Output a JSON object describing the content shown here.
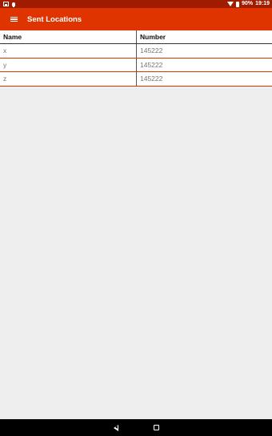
{
  "status_bar": {
    "icons_left": [
      "image-icon",
      "bulb-icon"
    ],
    "icons_right": [
      "wifi-icon",
      "battery-icon"
    ],
    "battery": "90%",
    "time": "19:19"
  },
  "app_bar": {
    "menu_icon": "hamburger-icon",
    "title": "Sent Locations"
  },
  "table": {
    "headers": [
      "Name",
      "Number"
    ],
    "rows": [
      [
        "x",
        "145222"
      ],
      [
        "y",
        "145222"
      ],
      [
        "z",
        "145222"
      ]
    ]
  },
  "nav_bar": {
    "buttons": [
      "back-icon",
      "home-icon"
    ]
  },
  "colors": {
    "status_bar": "#a01c00",
    "app_bar": "#e03400",
    "row_divider": "#e03400",
    "background": "#eeeeee"
  }
}
